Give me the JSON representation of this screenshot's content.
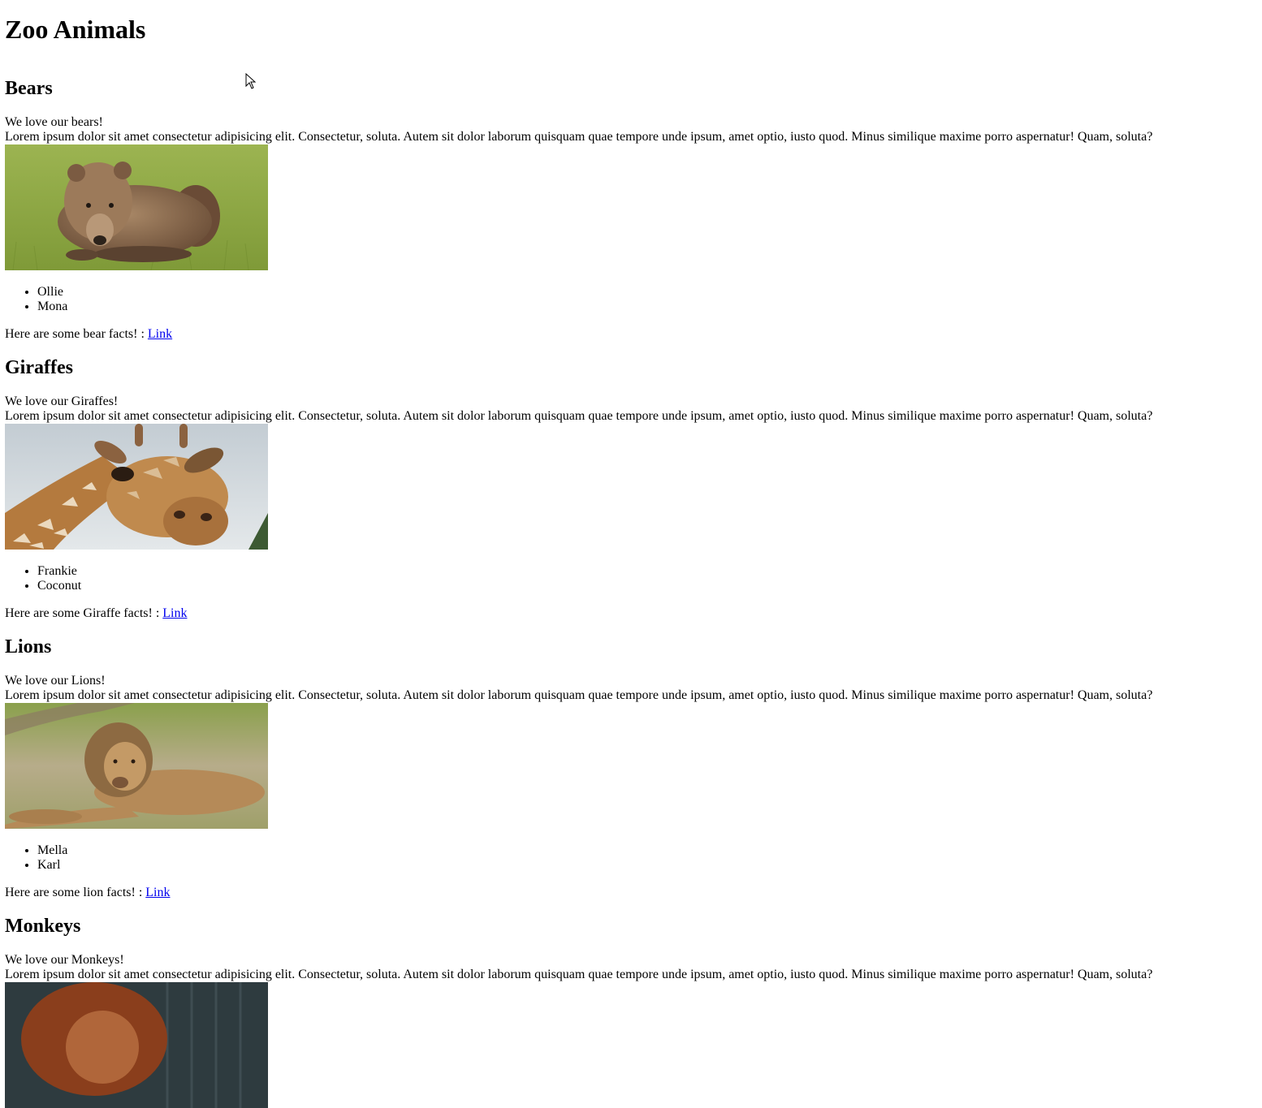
{
  "page": {
    "title": "Zoo Animals"
  },
  "sections": [
    {
      "heading": "Bears",
      "tagline": "We love our bears!",
      "lorem": "Lorem ipsum dolor sit amet consectetur adipisicing elit. Consectetur, soluta. Autem sit dolor laborum quisquam quae tempore unde ipsum, amet optio, iusto quod. Minus similique maxime porro aspernatur! Quam, soluta?",
      "names": [
        "Ollie",
        "Mona"
      ],
      "facts_text": "Here are some bear facts! : ",
      "link_label": "Link"
    },
    {
      "heading": "Giraffes",
      "tagline": "We love our Giraffes!",
      "lorem": "Lorem ipsum dolor sit amet consectetur adipisicing elit. Consectetur, soluta. Autem sit dolor laborum quisquam quae tempore unde ipsum, amet optio, iusto quod. Minus similique maxime porro aspernatur! Quam, soluta?",
      "names": [
        "Frankie",
        "Coconut"
      ],
      "facts_text": "Here are some Giraffe facts! : ",
      "link_label": "Link"
    },
    {
      "heading": "Lions",
      "tagline": "We love our Lions!",
      "lorem": "Lorem ipsum dolor sit amet consectetur adipisicing elit. Consectetur, soluta. Autem sit dolor laborum quisquam quae tempore unde ipsum, amet optio, iusto quod. Minus similique maxime porro aspernatur! Quam, soluta?",
      "names": [
        "Mella",
        "Karl"
      ],
      "facts_text": "Here are some lion facts! : ",
      "link_label": "Link"
    },
    {
      "heading": "Monkeys",
      "tagline": "We love our Monkeys!",
      "lorem": "Lorem ipsum dolor sit amet consectetur adipisicing elit. Consectetur, soluta. Autem sit dolor laborum quisquam quae tempore unde ipsum, amet optio, iusto quod. Minus similique maxime porro aspernatur! Quam, soluta?"
    }
  ],
  "colors": {
    "link": "#0000ee",
    "text": "#000000",
    "background": "#ffffff"
  },
  "icons": {
    "cursor": "mouse-pointer-icon"
  }
}
